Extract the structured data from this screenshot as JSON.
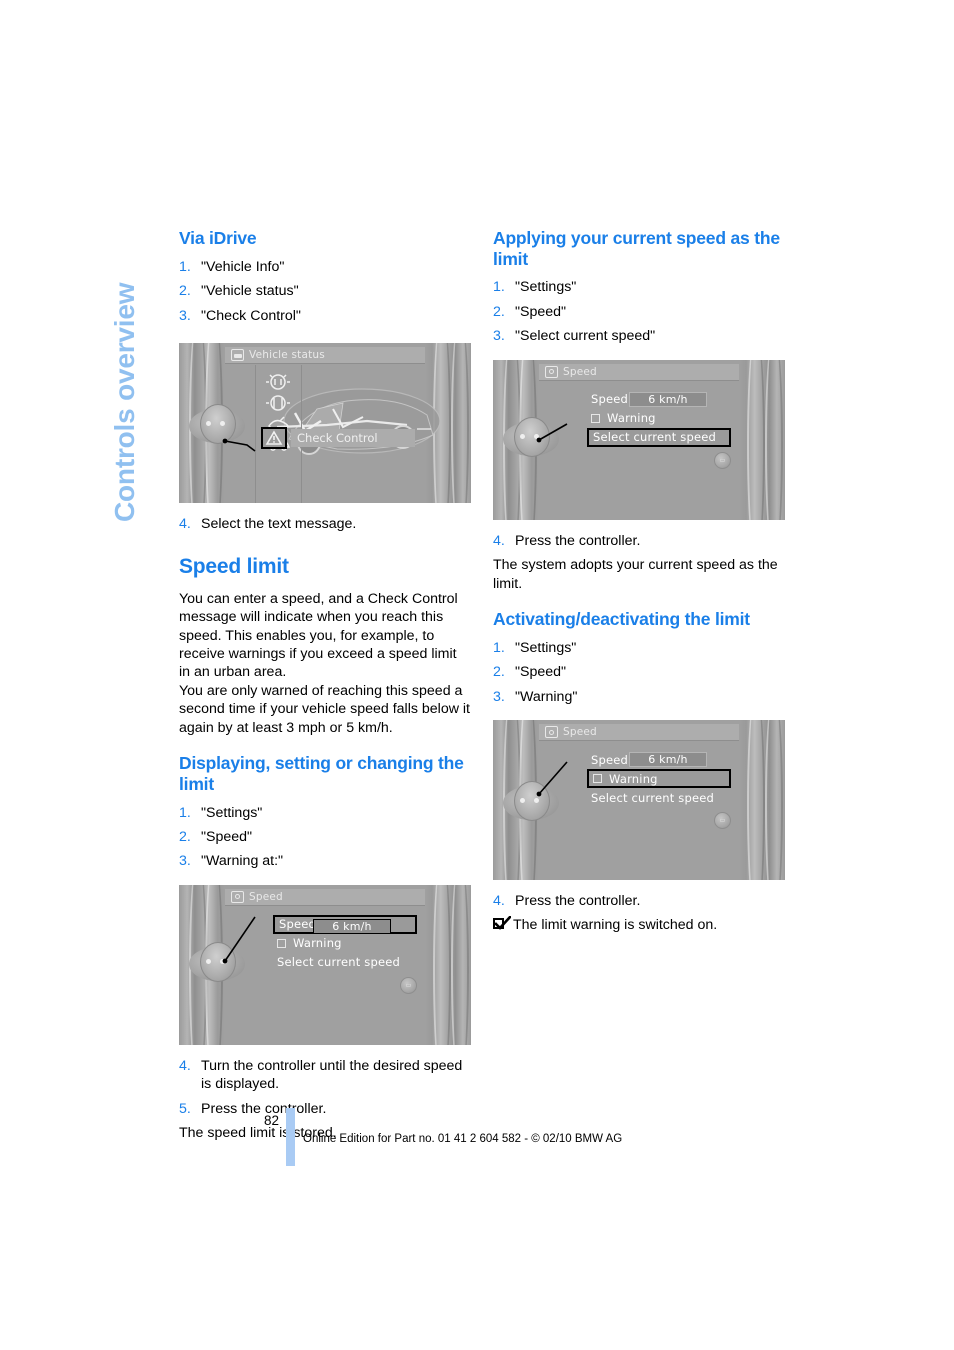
{
  "chapter_tab": {
    "label": "Controls overview"
  },
  "left_column": {
    "section1": {
      "heading": "Via iDrive",
      "steps": [
        {
          "num": "1.",
          "text": "\"Vehicle Info\""
        },
        {
          "num": "2.",
          "text": "\"Vehicle status\""
        },
        {
          "num": "3.",
          "text": "\"Check Control\""
        }
      ],
      "figure": {
        "name": "vehicle-status-screen",
        "header_label": "Vehicle status",
        "header_icon": "car-icon",
        "selected_item": "Check Control",
        "icon_list": [
          "brake-warning-icon",
          "brake-pad-icon",
          "engine-oil-icon",
          "vehicle-icon",
          "warning-triangle-icon"
        ]
      },
      "steps_after": [
        {
          "num": "4.",
          "text": "Select the text message."
        }
      ]
    },
    "section2": {
      "title": "Speed limit",
      "paragraphs": [
        "You can enter a speed, and a Check Control message will indicate when you reach this speed. This enables you, for example, to receive warnings if you exceed a speed limit in an urban area.",
        "You are only warned of reaching this speed a second time if your vehicle speed falls below it again by at least 3 mph or 5 km/h."
      ],
      "sub_heading": "Displaying, setting or changing the limit",
      "steps": [
        {
          "num": "1.",
          "text": "\"Settings\""
        },
        {
          "num": "2.",
          "text": "\"Speed\""
        },
        {
          "num": "3.",
          "text": "\"Warning at:\""
        }
      ],
      "figure": {
        "name": "speed-menu-speed-row-selected",
        "header_label": "Speed",
        "header_icon": "gear-icon",
        "rows": [
          {
            "label": "Speed",
            "value": "6 km/h",
            "selected": true,
            "checkbox": false
          },
          {
            "label": "Warning",
            "value": "",
            "selected": false,
            "checkbox": true
          },
          {
            "label": "Select current speed",
            "value": "",
            "selected": false,
            "checkbox": false
          }
        ]
      },
      "steps_after": [
        {
          "num": "4.",
          "text": "Turn the controller until the desired speed is displayed."
        },
        {
          "num": "5.",
          "text": "Press the controller."
        }
      ],
      "result": "The speed limit is stored."
    }
  },
  "right_column": {
    "section1": {
      "heading": "Applying your current speed as the limit",
      "steps": [
        {
          "num": "1.",
          "text": "\"Settings\""
        },
        {
          "num": "2.",
          "text": "\"Speed\""
        },
        {
          "num": "3.",
          "text": "\"Select current speed\""
        }
      ],
      "figure": {
        "name": "speed-menu-select-current-speed-selected",
        "header_label": "Speed",
        "header_icon": "gear-icon",
        "rows": [
          {
            "label": "Speed",
            "value": "6 km/h",
            "selected": false,
            "checkbox": false
          },
          {
            "label": "Warning",
            "value": "",
            "selected": false,
            "checkbox": true
          },
          {
            "label": "Select current speed",
            "value": "",
            "selected": true,
            "checkbox": false
          }
        ]
      },
      "steps_after": [
        {
          "num": "4.",
          "text": "Press the controller."
        }
      ],
      "result": "The system adopts your current speed as the limit."
    },
    "section2": {
      "heading": "Activating/deactivating the limit",
      "steps": [
        {
          "num": "1.",
          "text": "\"Settings\""
        },
        {
          "num": "2.",
          "text": "\"Speed\""
        },
        {
          "num": "3.",
          "text": "\"Warning\""
        }
      ],
      "figure": {
        "name": "speed-menu-warning-selected",
        "header_label": "Speed",
        "header_icon": "gear-icon",
        "rows": [
          {
            "label": "Speed",
            "value": "6 km/h",
            "selected": false,
            "checkbox": false
          },
          {
            "label": "Warning",
            "value": "",
            "selected": true,
            "checkbox": true
          },
          {
            "label": "Select current speed",
            "value": "",
            "selected": false,
            "checkbox": false
          }
        ]
      },
      "steps_after": [
        {
          "num": "4.",
          "text": "Press the controller."
        }
      ],
      "result_checkbox": "The limit warning is switched on."
    }
  },
  "footer": {
    "page_number": "82",
    "text": "Online Edition for Part no. 01 41 2 604 582 - © 02/10 BMW AG"
  },
  "colors": {
    "heading_blue": "#1a7fe8",
    "chapter_tab_blue": "#90c0f0",
    "footer_bar_blue": "#a9cbf4"
  }
}
